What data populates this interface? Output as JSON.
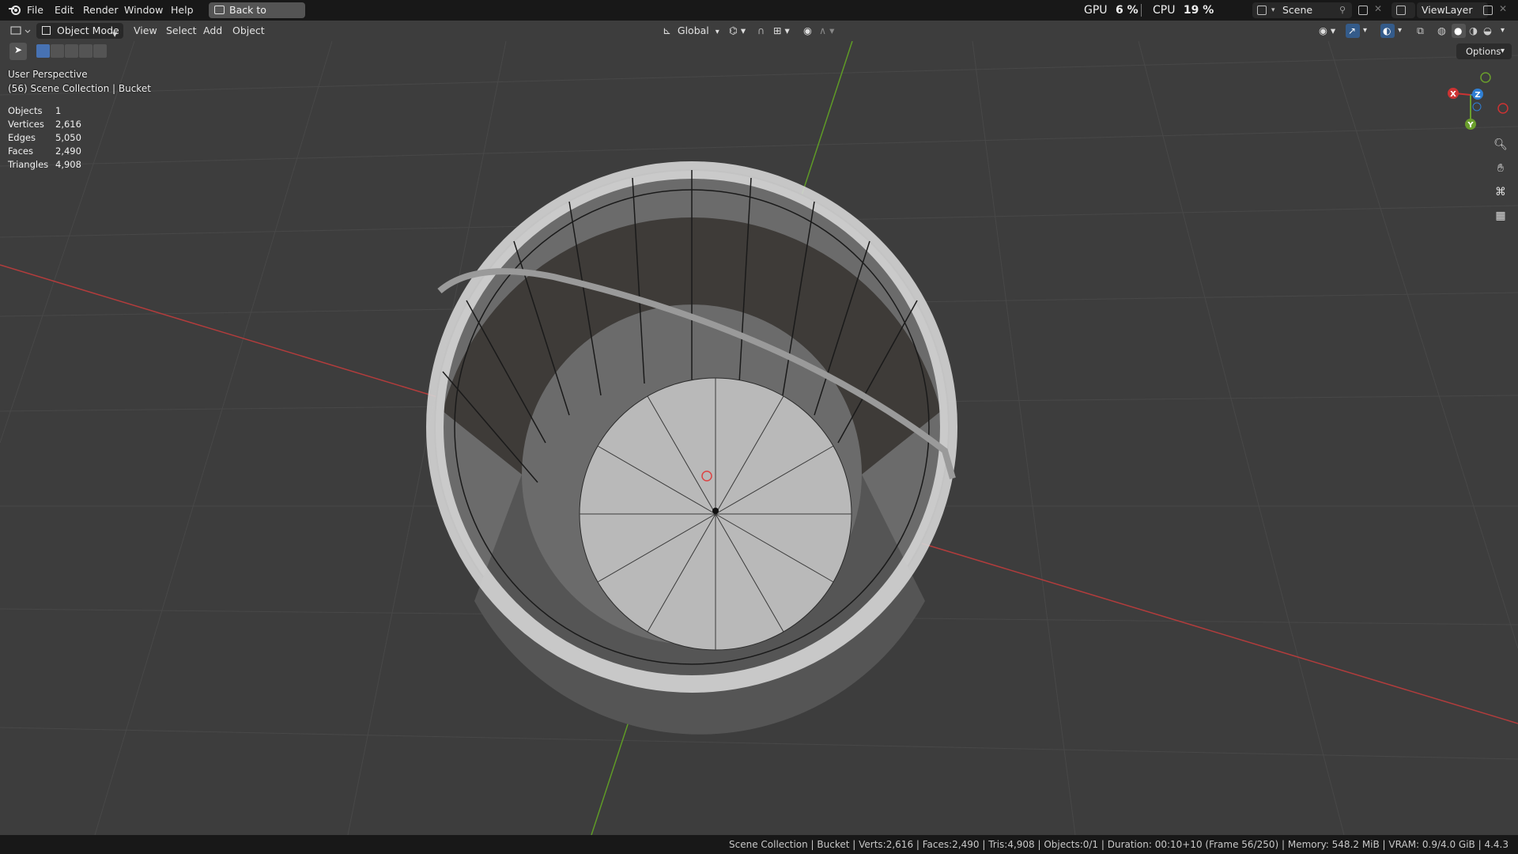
{
  "menu": {
    "items": [
      "File",
      "Edit",
      "Render",
      "Window",
      "Help"
    ],
    "back_button": "Back to Previous"
  },
  "perf": {
    "gpu_label": "GPU",
    "gpu_value": "6 %",
    "cpu_label": "CPU",
    "cpu_value": "19 %"
  },
  "scene_field": "Scene",
  "viewlayer_field": "ViewLayer",
  "viewport_header": {
    "mode": "Object Mode",
    "menus": [
      "View",
      "Select",
      "Add",
      "Object"
    ],
    "transform_orientation": "Global",
    "options": "Options"
  },
  "overlay": {
    "view_name": "User Perspective",
    "collection_info": "(56) Scene Collection | Bucket",
    "stats": [
      {
        "label": "Objects",
        "value": "1"
      },
      {
        "label": "Vertices",
        "value": "2,616"
      },
      {
        "label": "Edges",
        "value": "5,050"
      },
      {
        "label": "Faces",
        "value": "2,490"
      },
      {
        "label": "Triangles",
        "value": "4,908"
      }
    ]
  },
  "gizmo": {
    "x": "X",
    "y": "Y",
    "z": "Z"
  },
  "statusbar": "Scene Collection | Bucket | Verts:2,616 | Faces:2,490 | Tris:4,908 | Objects:0/1 | Duration: 00:10+10 (Frame 56/250) | Memory: 548.2 MiB | VRAM: 0.9/4.0 GiB | 4.4.3",
  "colors": {
    "x_axis": "#b23c3c",
    "y_axis": "#5f9b26",
    "z_axis": "#2f7fd4",
    "viewport_bg": "#3d3d3d"
  }
}
